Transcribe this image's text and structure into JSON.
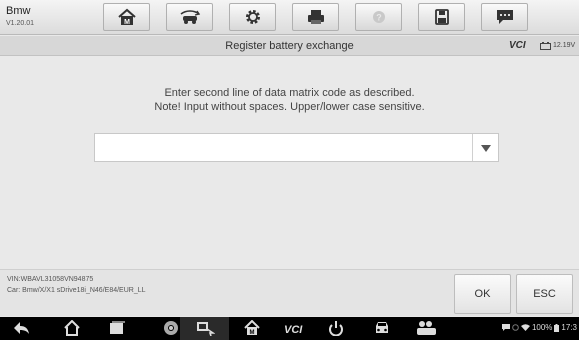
{
  "app": {
    "name": "Bmw",
    "version": "V1.20.01"
  },
  "toolbar": {
    "buttons": [
      {
        "icon": "home-icon"
      },
      {
        "icon": "vehicle-swap-icon"
      },
      {
        "icon": "settings-icon"
      },
      {
        "icon": "print-icon"
      },
      {
        "icon": "help-icon"
      },
      {
        "icon": "save-icon"
      },
      {
        "icon": "message-icon"
      }
    ]
  },
  "titlebar": {
    "title": "Register battery exchange",
    "vci_label": "VCI",
    "voltage": "12.19V"
  },
  "main": {
    "instruction_line1": "Enter second line of data matrix code as described.",
    "instruction_line2": "Note! Input without spaces. Upper/lower case sensitive.",
    "combo_value": ""
  },
  "info": {
    "vin": "VIN:WBAVL31058VN94875",
    "car": "Car: Bmw/X/X1 sDrive18i_N46/E84/EUR_LL"
  },
  "actions": {
    "ok": "OK",
    "esc": "ESC"
  },
  "statusbar": {
    "battery": "100%",
    "time": "17:3"
  },
  "colors": {
    "toolbar_bg": "#e6e6e6",
    "main_bg": "#e9e9e9",
    "navbar_bg": "#000000"
  }
}
